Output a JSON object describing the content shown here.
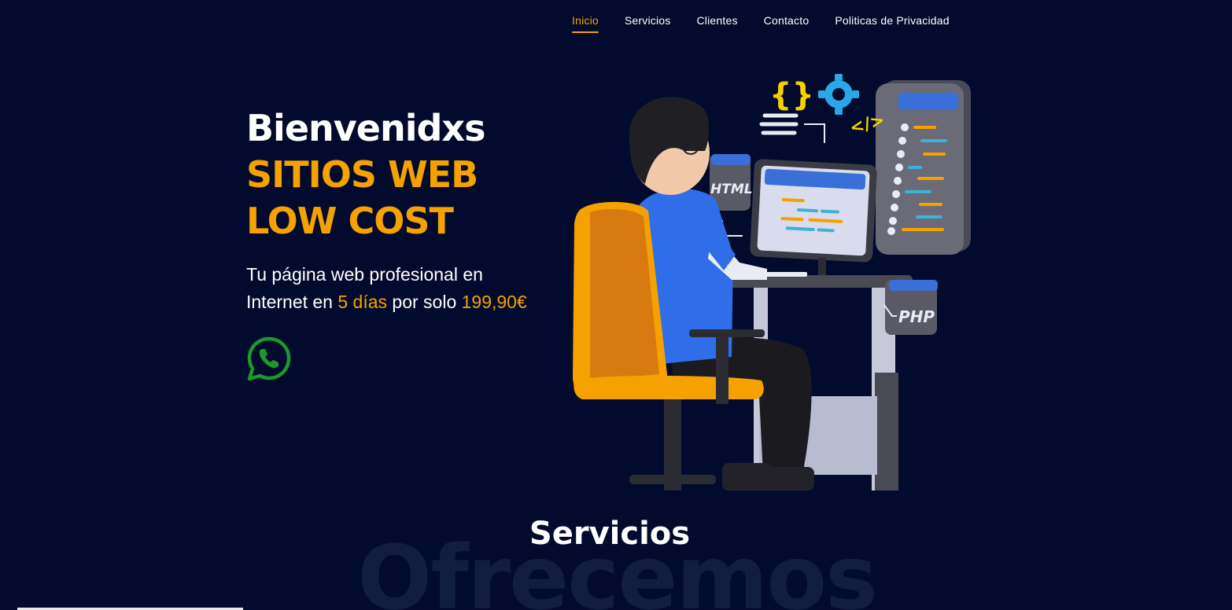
{
  "nav": {
    "items": [
      {
        "label": "Inicio",
        "active": true
      },
      {
        "label": "Servicios",
        "active": false
      },
      {
        "label": "Clientes",
        "active": false
      },
      {
        "label": "Contacto",
        "active": false
      },
      {
        "label": "Politicas de Privacidad",
        "active": false
      }
    ]
  },
  "hero": {
    "title_line1": "Bienvenidxs",
    "title_line2": "SITIOS WEB",
    "title_line3": "LOW COST",
    "subtitle_part1": "Tu página web profesional en",
    "subtitle_part2": "Internet en ",
    "subtitle_highlight1": "5 días",
    "subtitle_part3": " por solo ",
    "subtitle_highlight2": "199,90€",
    "whatsapp_icon": "whatsapp-icon"
  },
  "illustration": {
    "html_tag": "HTML",
    "php_tag": "PHP",
    "braces": "{}",
    "code_tag": "</>"
  },
  "services": {
    "title": "Servicios",
    "background_text": "Ofrecemos"
  },
  "colors": {
    "background": "#020b2d",
    "accent": "#f5a100",
    "whatsapp": "#1a9a2a"
  }
}
